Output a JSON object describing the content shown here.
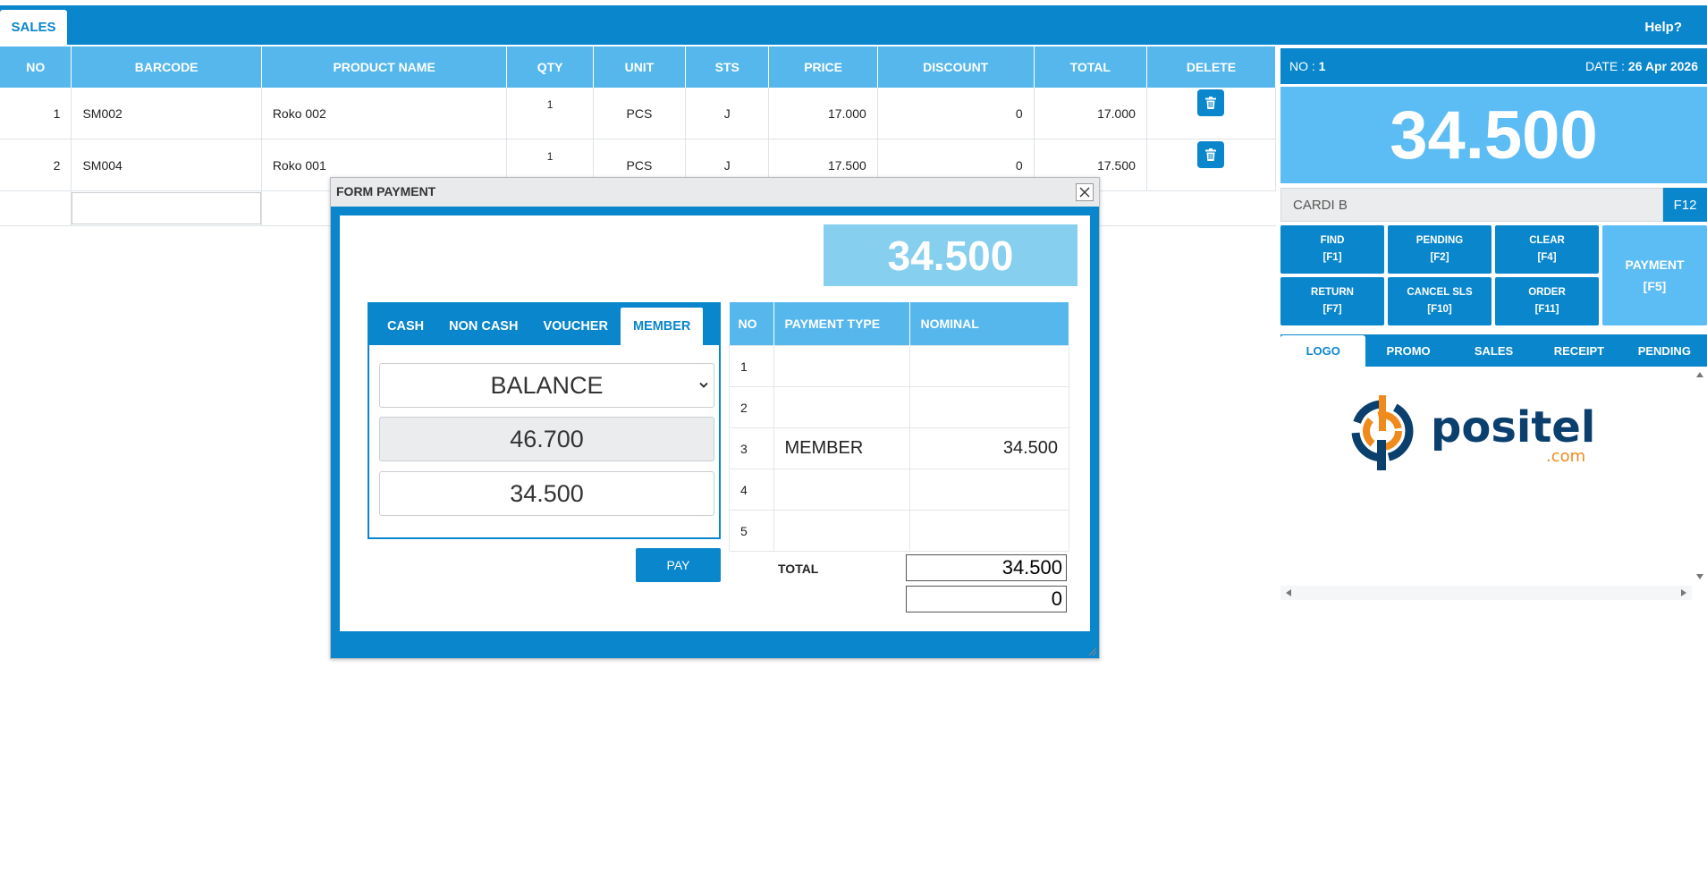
{
  "topbar": {
    "tab_sales": "SALES",
    "help": "Help?"
  },
  "sales_table": {
    "headers": [
      "NO",
      "BARCODE",
      "PRODUCT NAME",
      "QTY",
      "UNIT",
      "STS",
      "PRICE",
      "DISCOUNT",
      "TOTAL",
      "DELETE"
    ],
    "rows": [
      {
        "no": "1",
        "barcode": "SM002",
        "product": "Roko 002",
        "qty": "1",
        "unit": "PCS",
        "sts": "J",
        "price": "17.000",
        "discount": "0",
        "total": "17.000"
      },
      {
        "no": "2",
        "barcode": "SM004",
        "product": "Roko 001",
        "qty": "1",
        "unit": "PCS",
        "sts": "J",
        "price": "17.500",
        "discount": "0",
        "total": "17.500"
      }
    ],
    "delete_icon": "trash-icon"
  },
  "right_panel": {
    "no_label": "NO : ",
    "no_value": "1",
    "date_label": "DATE : ",
    "date_value": "26 Apr 2026",
    "grand_total": "34.500",
    "customer": "CARDI B",
    "f12": "F12",
    "buttons": {
      "find": "FIND",
      "find_key": "[F1]",
      "pending": "PENDING",
      "pending_key": "[F2]",
      "clear": "CLEAR",
      "clear_key": "[F4]",
      "return": "RETURN",
      "return_key": "[F7]",
      "cancel": "CANCEL SLS",
      "cancel_key": "[F10]",
      "order": "ORDER",
      "order_key": "[F11]",
      "payment": "PAYMENT",
      "payment_key": "[F5]"
    },
    "tabs": [
      "LOGO",
      "PROMO",
      "SALES",
      "RECEIPT",
      "PENDING"
    ],
    "logo": {
      "name": "positel-logo",
      "text": "positel",
      "suffix": ".com"
    }
  },
  "payment_form": {
    "title": "FORM PAYMENT",
    "total": "34.500",
    "tabs": [
      "CASH",
      "NON CASH",
      "VOUCHER",
      "MEMBER"
    ],
    "active_tab": "MEMBER",
    "select_value": "BALANCE",
    "balance_value": "46.700",
    "amount_value": "34.500",
    "pay_label": "PAY",
    "table_headers": [
      "NO",
      "PAYMENT TYPE",
      "NOMINAL"
    ],
    "table_rows": [
      {
        "no": "1",
        "type": "",
        "nominal": ""
      },
      {
        "no": "2",
        "type": "",
        "nominal": ""
      },
      {
        "no": "3",
        "type": "MEMBER",
        "nominal": "34.500"
      },
      {
        "no": "4",
        "type": "",
        "nominal": ""
      },
      {
        "no": "5",
        "type": "",
        "nominal": ""
      }
    ],
    "total_label": "TOTAL",
    "total_value": "34.500",
    "change_value": "0"
  },
  "colors": {
    "primary": "#0a86cc",
    "light": "#56b7ec",
    "accent": "#5cbcf4",
    "logo_blue": "#0a3f6e",
    "logo_orange": "#f08a1c"
  }
}
